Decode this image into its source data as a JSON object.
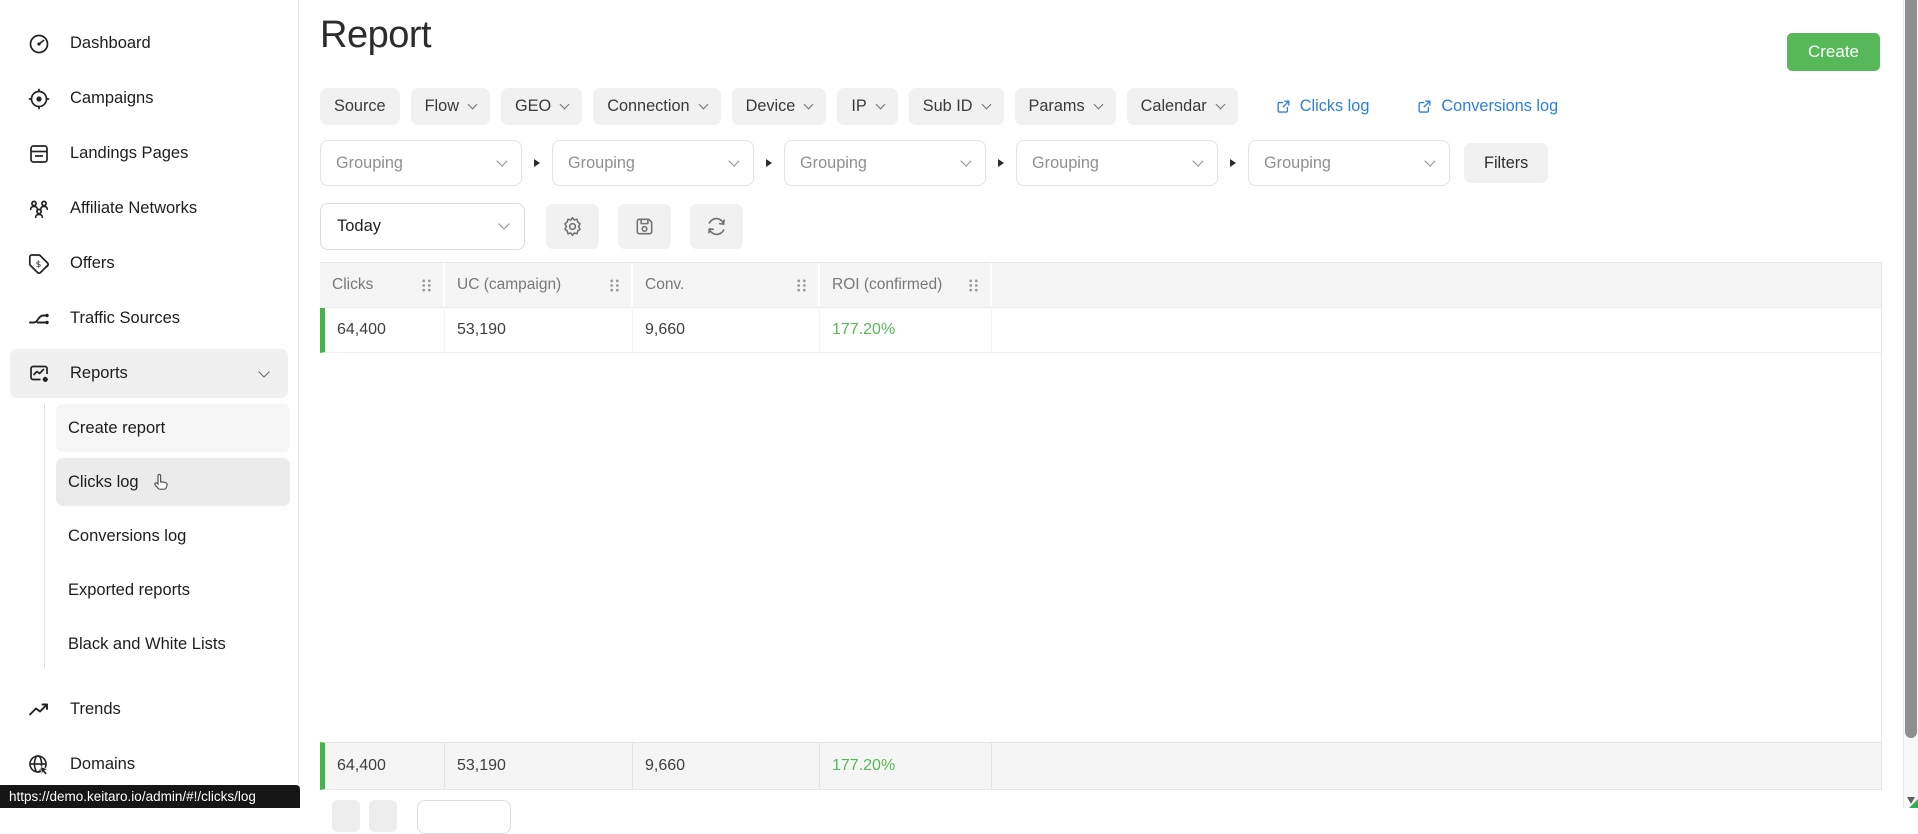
{
  "app": {
    "title": "Report",
    "create_button": "Create",
    "status_url": "https://demo.keitaro.io/admin/#!/clicks/log"
  },
  "sidebar": {
    "items": [
      {
        "label": "Dashboard"
      },
      {
        "label": "Campaigns"
      },
      {
        "label": "Landings Pages"
      },
      {
        "label": "Affiliate Networks"
      },
      {
        "label": "Offers"
      },
      {
        "label": "Traffic Sources"
      },
      {
        "label": "Reports"
      },
      {
        "label": "Trends"
      },
      {
        "label": "Domains"
      }
    ],
    "reports_submenu": [
      {
        "label": "Create report"
      },
      {
        "label": "Clicks log"
      },
      {
        "label": "Conversions log"
      },
      {
        "label": "Exported reports"
      },
      {
        "label": "Black and White Lists"
      }
    ]
  },
  "toolbar": {
    "chips": [
      {
        "label": "Source"
      },
      {
        "label": "Flow"
      },
      {
        "label": "GEO"
      },
      {
        "label": "Connection"
      },
      {
        "label": "Device"
      },
      {
        "label": "IP"
      },
      {
        "label": "Sub ID"
      },
      {
        "label": "Params"
      },
      {
        "label": "Calendar"
      }
    ],
    "links": [
      {
        "label": "Clicks log"
      },
      {
        "label": "Conversions log"
      }
    ],
    "groupings": [
      {
        "value": "Grouping"
      },
      {
        "value": "Grouping"
      },
      {
        "value": "Grouping"
      },
      {
        "value": "Grouping"
      },
      {
        "value": "Grouping"
      }
    ],
    "filters_button": "Filters",
    "date_select": "Today"
  },
  "table": {
    "columns": [
      {
        "label": "Clicks"
      },
      {
        "label": "UC (campaign)"
      },
      {
        "label": "Conv."
      },
      {
        "label": "ROI (confirmed)"
      }
    ],
    "row": [
      "64,400",
      "53,190",
      "9,660",
      "177.20%"
    ],
    "footer": [
      "64,400",
      "53,190",
      "9,660",
      "177.20%"
    ]
  },
  "colors": {
    "accent_green": "#57b859",
    "roi_green": "#57b857",
    "row_marker_green": "#43b649",
    "link_blue": "#2e7fd8"
  },
  "icons": {
    "sidebar": [
      "gauge-icon",
      "target-icon",
      "pages-icon",
      "people-icon",
      "tag-icon",
      "split-icon",
      "report-chart-icon",
      "trend-up-icon",
      "globe-icon"
    ],
    "toolbar": [
      "gear-icon",
      "save-icon",
      "refresh-icon",
      "external-link-icon"
    ],
    "table": [
      "drag-handle-icon"
    ],
    "pointer": [
      "hand-cursor-icon"
    ]
  }
}
